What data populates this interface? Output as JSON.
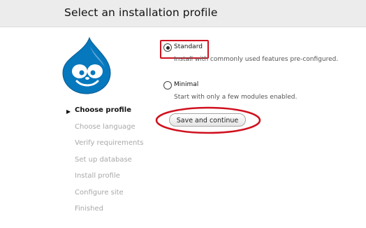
{
  "header": {
    "title": "Select an installation profile"
  },
  "logo": {
    "icon": "drupal-drop-icon",
    "color": "#0077c0"
  },
  "steps": [
    {
      "label": "Choose profile",
      "active": true
    },
    {
      "label": "Choose language",
      "active": false
    },
    {
      "label": "Verify requirements",
      "active": false
    },
    {
      "label": "Set up database",
      "active": false
    },
    {
      "label": "Install profile",
      "active": false
    },
    {
      "label": "Configure site",
      "active": false
    },
    {
      "label": "Finished",
      "active": false
    }
  ],
  "step_marker": "▶",
  "profiles": [
    {
      "label": "Standard",
      "description": "Install with commonly used features pre-configured.",
      "selected": true
    },
    {
      "label": "Minimal",
      "description": "Start with only a few modules enabled.",
      "selected": false
    }
  ],
  "actions": {
    "save_label": "Save and continue"
  },
  "annotations": {
    "highlight_color": "#d0101e"
  }
}
